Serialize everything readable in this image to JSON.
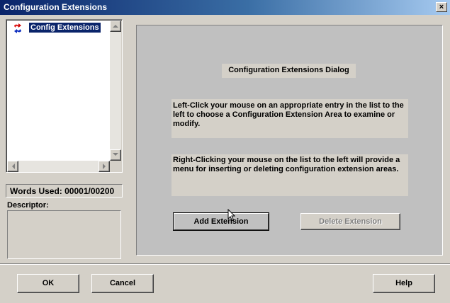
{
  "window": {
    "title": "Configuration Extensions",
    "close_glyph": "×"
  },
  "tree": {
    "items": [
      {
        "label": "Config Extensions",
        "icon": "config-extension-icon",
        "selected": true
      }
    ]
  },
  "status": {
    "words_used_label": "Words Used: 00001/00200"
  },
  "descriptor": {
    "label": "Descriptor:",
    "value": ""
  },
  "panel": {
    "dialog_title": "Configuration Extensions Dialog",
    "paragraph1": "Left-Click your mouse on an appropriate entry in the list to the left to choose a Configuration Extension Area to examine or modify.",
    "paragraph2": "Right-Clicking your mouse on the list to the left will provide a menu for inserting or deleting configuration extension areas.",
    "add_button": "Add Extension",
    "delete_button": "Delete Extension"
  },
  "buttons": {
    "ok": "OK",
    "cancel": "Cancel",
    "help": "Help"
  },
  "colors": {
    "titlebar_start": "#0a246a",
    "titlebar_end": "#a6caf0",
    "dialog_bg": "#d4d0c8",
    "panel_bg": "#c0c0c0",
    "selection": "#0a246a"
  }
}
